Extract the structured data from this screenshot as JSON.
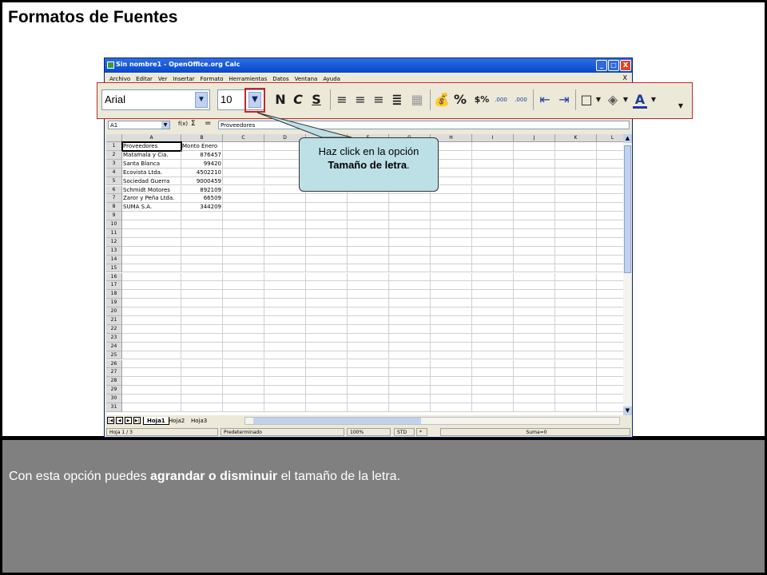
{
  "slide": {
    "title": "Formatos de Fuentes",
    "caption_pre": "Con esta opción puedes ",
    "caption_bold": "agrandar o disminuir",
    "caption_post": " el tamaño de la letra."
  },
  "window": {
    "title": "Sin nombre1 - OpenOffice.org Calc",
    "buttons": [
      "_",
      "□",
      "X"
    ],
    "menu": [
      "Archivo",
      "Editar",
      "Ver",
      "Insertar",
      "Formato",
      "Herramientas",
      "Datos",
      "Ventana",
      "Ayuda"
    ],
    "menu_close": "X"
  },
  "toolbar": {
    "font_name": "Arial",
    "font_size": "10",
    "bold_label": "N",
    "italic_label": "C",
    "underline_label": "S",
    "percent_label": "%",
    "currency_label": "$%",
    "decimal_add_label": ".000",
    "decimal_remove_label": ".000",
    "font_color_label": "A"
  },
  "formula_bar": {
    "name_box": "A1",
    "fx": "f(x)",
    "sum": "Σ",
    "equals": "=",
    "value": "Proveedores"
  },
  "grid": {
    "columns": [
      "A",
      "B",
      "C",
      "D",
      "E",
      "F",
      "G",
      "H",
      "I",
      "J",
      "K",
      "L"
    ],
    "rows": [
      "1",
      "2",
      "3",
      "4",
      "5",
      "6",
      "7",
      "8",
      "9",
      "10",
      "11",
      "12",
      "13",
      "14",
      "15",
      "16",
      "17",
      "18",
      "19",
      "20",
      "21",
      "22",
      "23",
      "24",
      "25",
      "26",
      "27",
      "28",
      "29",
      "30",
      "31"
    ],
    "data": [
      [
        "Proveedores",
        "Monto Enero"
      ],
      [
        "Matamala y Cia.",
        "876457"
      ],
      [
        "Santa Blanca",
        "99420"
      ],
      [
        "Ecovista Ltda.",
        "4502210"
      ],
      [
        "Sociedad Guerra",
        "9000459"
      ],
      [
        "Schmidt Motores",
        "892109"
      ],
      [
        "Zaror y Peña Ltda.",
        "66509"
      ],
      [
        "SUMA S.A.",
        "344209"
      ]
    ]
  },
  "sheets": {
    "tabs": [
      "Hoja1",
      "Hoja2",
      "Hoja3"
    ],
    "active": "Hoja1"
  },
  "status": {
    "sheet": "Hoja 1 / 3",
    "style": "Predeterminado",
    "zoom": "100%",
    "mode": "STD",
    "modified": "*",
    "sum": "Suma=0"
  },
  "callout": {
    "pre": "Haz click en la opción ",
    "bold": "Tamaño de letra",
    "post": "."
  }
}
